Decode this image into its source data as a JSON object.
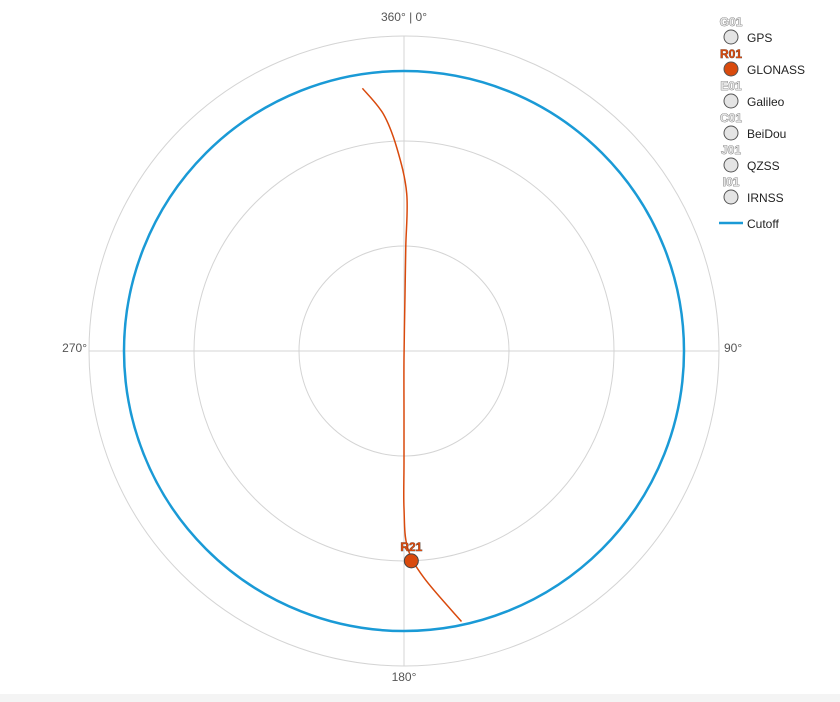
{
  "chart_data": {
    "type": "polar-skyplot",
    "direction_labels": {
      "north": "360° | 0°",
      "east": "90°",
      "south": "180°",
      "west": "270°"
    },
    "elevation_rings": [
      0,
      30,
      60
    ],
    "cutoff": {
      "name": "Cutoff",
      "elevation": 10,
      "color": "#1a9ad6"
    },
    "legend": [
      {
        "tag": "G01",
        "name": "GPS",
        "color": "#e4e4e4",
        "active": false
      },
      {
        "tag": "R01",
        "name": "GLONASS",
        "color": "#d94a0d",
        "active": true
      },
      {
        "tag": "E01",
        "name": "Galileo",
        "color": "#e4e4e4",
        "active": false
      },
      {
        "tag": "C01",
        "name": "BeiDou",
        "color": "#e4e4e4",
        "active": false
      },
      {
        "tag": "J01",
        "name": "QZSS",
        "color": "#e4e4e4",
        "active": false
      },
      {
        "tag": "I01",
        "name": "IRNSS",
        "color": "#e4e4e4",
        "active": false
      }
    ],
    "satellites": [
      {
        "label": "R21",
        "system": "GLONASS",
        "color": "#d94a0d",
        "azimuth": 178,
        "elevation": 30,
        "track": [
          {
            "azimuth": 351,
            "elevation": 14
          },
          {
            "azimuth": 355,
            "elevation": 22
          },
          {
            "azimuth": 358,
            "elevation": 32
          },
          {
            "azimuth": 1,
            "elevation": 45
          },
          {
            "azimuth": 1,
            "elevation": 60
          },
          {
            "azimuth": 1,
            "elevation": 74
          },
          {
            "azimuth": 180,
            "elevation": 88
          },
          {
            "azimuth": 180,
            "elevation": 72
          },
          {
            "azimuth": 180,
            "elevation": 58
          },
          {
            "azimuth": 180,
            "elevation": 45
          },
          {
            "azimuth": 179,
            "elevation": 34
          },
          {
            "azimuth": 175,
            "elevation": 25
          },
          {
            "azimuth": 168,
            "elevation": 11
          }
        ]
      }
    ]
  }
}
